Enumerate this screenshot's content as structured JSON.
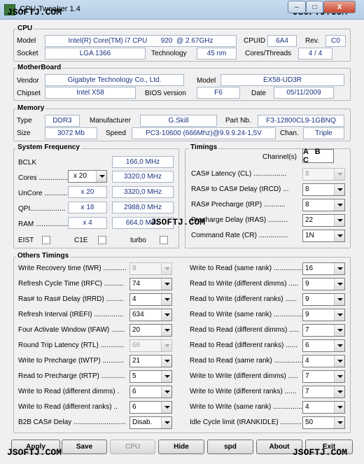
{
  "window": {
    "title": "CPU-Tweaker 1.4",
    "watermark": "JSOFTJ.COM",
    "min": "–",
    "max": "□",
    "close": "X"
  },
  "cpu": {
    "title": "CPU",
    "model_label": "Model",
    "model": "Intel(R) Core(TM) i7 CPU",
    "model_num": "920",
    "model_freq": "@ 2.67GHz",
    "cpuid_label": "CPUID",
    "cpuid": "6A4",
    "rev_label": "Rev.",
    "rev": "C0",
    "socket_label": "Socket",
    "socket": "LGA 1366",
    "tech_label": "Technology",
    "tech": "45 nm",
    "cores_label": "Cores/Threads",
    "cores": "4 / 4"
  },
  "mb": {
    "title": "MotherBoard",
    "vendor_label": "Vendor",
    "vendor": "Gigabyte Technology Co., Ltd.",
    "model_label": "Model",
    "model": "EX58-UD3R",
    "chipset_label": "Chipset",
    "chipset": "Intel X58",
    "bios_label": "BIOS version",
    "bios": "F6",
    "date_label": "Date",
    "date": "05/11/2009"
  },
  "mem": {
    "title": "Memory",
    "type_label": "Type",
    "type": "DDR3",
    "manu_label": "Manufacturer",
    "manu": "G.Skill",
    "part_label": "Part Nb.",
    "part": "F3-12800CL9-1GBNQ",
    "size_label": "Size",
    "size": "3072 Mb",
    "speed_label": "Speed",
    "speed": "PC3-10600 (666Mhz)@9.9.9.24-1,5V",
    "chan_label": "Chan.",
    "chan": "Triple"
  },
  "sysfreq": {
    "title": "System Frequency",
    "bclk_label": "BCLK",
    "bclk": "166,0 MHz",
    "cores_label": "Cores ..................",
    "cores_mult": "x 20",
    "cores_val": "3320,0 MHz",
    "uncore_label": "UnCore ..................",
    "uncore_mult": "x 20",
    "uncore_val": "3320,0 MHz",
    "qpi_label": "QPI..................",
    "qpi_mult": "x 18",
    "qpi_val": "2988,0 MHz",
    "ram_label": "RAM ..................",
    "ram_mult": "x 4",
    "ram_val": "664,0 MHz",
    "eist": "EIST",
    "c1e": "C1E",
    "turbo": "turbo"
  },
  "timings": {
    "title": "Timings",
    "channels_label": "Channel(s)",
    "channels": "A B C",
    "rows": [
      {
        "label": "CAS# Latency (CL) .................",
        "value": "8",
        "disabled": true
      },
      {
        "label": "RAS# to CAS# Delay (tRCD) ...",
        "value": "8",
        "disabled": false
      },
      {
        "label": "RAS# Precharge (tRP) ...........",
        "value": "8",
        "disabled": false
      },
      {
        "label": "Precharge Delay (tRAS) ..........",
        "value": "22",
        "disabled": false
      },
      {
        "label": "Command Rate (CR) ...............",
        "value": "1N",
        "disabled": false
      }
    ]
  },
  "other": {
    "title": "Others Timings",
    "left": [
      {
        "label": "Write Recovery time (tWR) ............",
        "value": "8",
        "disabled": true
      },
      {
        "label": "Refresh Cycle Time (tRFC) ..........",
        "value": "74",
        "disabled": false
      },
      {
        "label": "Ras# to Ras# Delay (tRRD) .........",
        "value": "4",
        "disabled": false
      },
      {
        "label": "Refresh Interval (tREFI) ...............",
        "value": "634",
        "disabled": false
      },
      {
        "label": "Four Activate Window (tFAW) .......",
        "value": "20",
        "disabled": false
      },
      {
        "label": "Round Trip Latency (RTL) ............",
        "value": "66",
        "disabled": true
      },
      {
        "label": "Write to Precharge (tWTP) ...........",
        "value": "21",
        "disabled": false
      },
      {
        "label": "Read to Precharge (tRTP) ............",
        "value": "5",
        "disabled": false
      },
      {
        "label": "Write to Read (different dimms) .",
        "value": "6",
        "disabled": false
      },
      {
        "label": "Write to Read (different ranks) ..",
        "value": "6",
        "disabled": false
      },
      {
        "label": "B2B CAS# Delay ...........................",
        "value": "Disab.",
        "disabled": false
      }
    ],
    "right": [
      {
        "label": "Write to Read (same rank) ...............",
        "value": "16"
      },
      {
        "label": "Read to Write (different dimms) .....",
        "value": "9"
      },
      {
        "label": "Read to Write (different ranks) ......",
        "value": "9"
      },
      {
        "label": "Read to Write (same rank) ...............",
        "value": "9"
      },
      {
        "label": "Read to Read (different dimms) .....",
        "value": "7"
      },
      {
        "label": "Read to Read (different ranks) ......",
        "value": "6"
      },
      {
        "label": "Read to Read (same rank) ...............",
        "value": "4"
      },
      {
        "label": "Write to Write (different dimms) .....",
        "value": "7"
      },
      {
        "label": "Write to Write (different ranks) ......",
        "value": "7"
      },
      {
        "label": "Write to Write (same rank) ...............",
        "value": "4"
      },
      {
        "label": "Idle Cycle limit (tRANKIDLE) ...........",
        "value": "50"
      }
    ]
  },
  "buttons": {
    "apply": "Apply",
    "save": "Save",
    "cpu": "CPU",
    "hide": "Hide",
    "spd": "spd",
    "about": "About",
    "exit": "Exit"
  }
}
